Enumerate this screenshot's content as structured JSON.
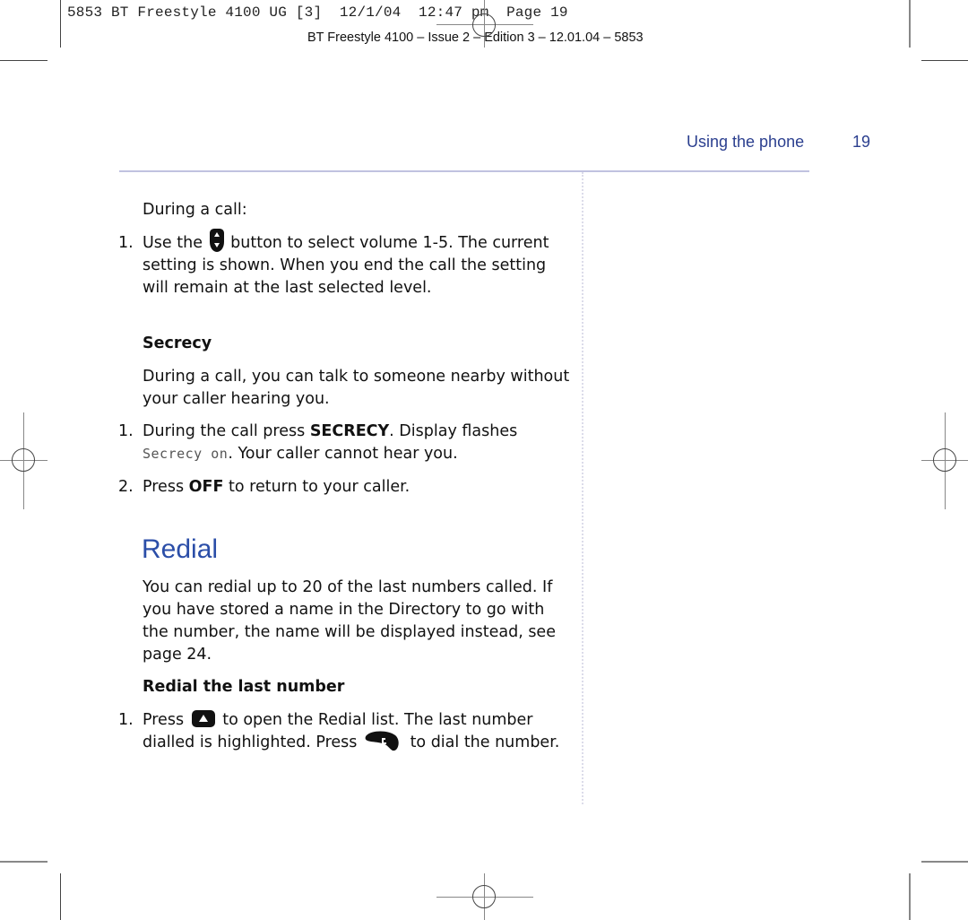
{
  "slug": {
    "print_line": "5853 BT Freestyle 4100 UG [3]  12/1/04  12:47 pm  Page 19",
    "edition_line": "BT Freestyle 4100 – Issue 2 – Edition 3 – 12.01.04 – 5853"
  },
  "running_head": {
    "section": "Using the phone",
    "page_number": "19"
  },
  "intro": {
    "label": "During a call:"
  },
  "volume_step": {
    "number": "1.",
    "before_icon": "Use the",
    "icon": "volume-up-down-button-icon",
    "after_icon": "button to select volume 1-5. The current setting is shown. When you end the call the setting will remain at the last selected level."
  },
  "secrecy": {
    "heading": "Secrecy",
    "description": "During a call, you can talk to someone nearby without your caller hearing you.",
    "steps": [
      {
        "number": "1.",
        "before": "During the call press",
        "key": "SECRECY",
        "middle": ". Display flashes",
        "display_text": "Secrecy on",
        "after": ". Your caller cannot hear you."
      },
      {
        "number": "2.",
        "before": "Press",
        "key": "OFF",
        "after": "to return to your caller."
      }
    ]
  },
  "redial": {
    "title": "Redial",
    "description": "You can redial up to 20 of the last numbers called. If you have stored a name in the Directory to go with the number, the name will be displayed instead, see page 24.",
    "subheading": "Redial the last number",
    "step": {
      "number": "1.",
      "before": "Press",
      "icon1": "up-arrow-button-icon",
      "middle": "to open the Redial list. The last number dialled is highlighted. Press",
      "icon2": "talk-button-icon",
      "after": "to dial the number."
    }
  },
  "colors": {
    "accent_blue": "#2b4ea8",
    "rule": "#c0c2e0",
    "text": "#111111"
  }
}
